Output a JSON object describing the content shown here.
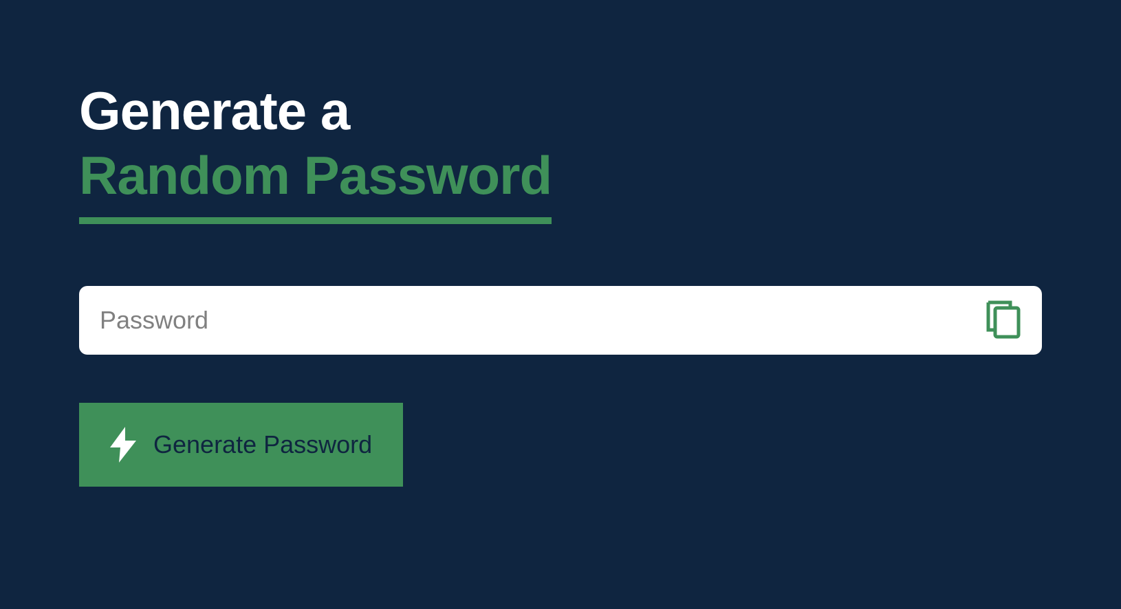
{
  "heading": {
    "line1": "Generate a",
    "line2": "Random Password"
  },
  "input": {
    "placeholder": "Password",
    "value": ""
  },
  "button": {
    "generate_label": "Generate Password"
  },
  "icons": {
    "copy": "copy-icon",
    "bolt": "bolt-icon"
  },
  "colors": {
    "background": "#0f2540",
    "accent": "#3f9059",
    "white": "#ffffff"
  }
}
